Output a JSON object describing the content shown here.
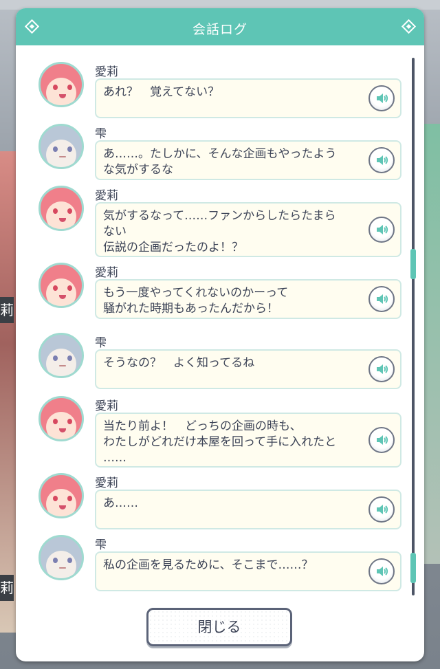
{
  "header": {
    "title": "会話ログ"
  },
  "messages": [
    {
      "speaker": "愛莉",
      "character": "airi",
      "text": "あれ？　覚えてない？"
    },
    {
      "speaker": "雫",
      "character": "shizuku",
      "text": "あ……。たしかに、そんな企画もやったよう\nな気がするな"
    },
    {
      "speaker": "愛莉",
      "character": "airi",
      "text": "気がするなって……ファンからしたらたまら\nない\n伝説の企画だったのよ！？"
    },
    {
      "speaker": "愛莉",
      "character": "airi",
      "text": "もう一度やってくれないのかーって\n騒がれた時期もあったんだから！"
    },
    {
      "speaker": "雫",
      "character": "shizuku",
      "text": "そうなの？　よく知ってるね"
    },
    {
      "speaker": "愛莉",
      "character": "airi",
      "text": "当たり前よ！　どっちの企画の時も、\nわたしがどれだけ本屋を回って手に入れたと\n……"
    },
    {
      "speaker": "愛莉",
      "character": "airi",
      "text": "あ……"
    },
    {
      "speaker": "雫",
      "character": "shizuku",
      "text": "私の企画を見るために、そこまで……？"
    }
  ],
  "background": {
    "name_tab_char": "莉"
  },
  "close_label": "閉じる",
  "colors": {
    "accent": "#5ec5b5",
    "text": "#3d4457",
    "bubble": "#fffdf0"
  },
  "icons": {
    "voice": "speaker-volume-icon",
    "header_ornament": "diamond-icon"
  }
}
